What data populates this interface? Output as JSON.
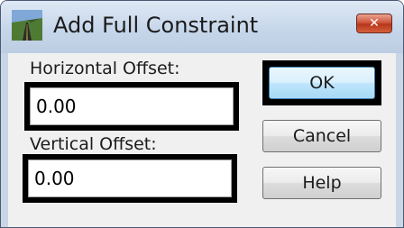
{
  "window": {
    "title": "Add Full Constraint",
    "app_icon": "road-app-icon",
    "close_icon": "close-icon",
    "close_glyph": "✕",
    "colors": {
      "close": "#c8452b",
      "ok_highlight": "#000000"
    }
  },
  "form": {
    "horizontal_offset": {
      "label": "Horizontal Offset:",
      "value": "0.00"
    },
    "vertical_offset": {
      "label": "Vertical Offset:",
      "value": "0.00"
    }
  },
  "buttons": {
    "ok": "OK",
    "cancel": "Cancel",
    "help": "Help"
  }
}
